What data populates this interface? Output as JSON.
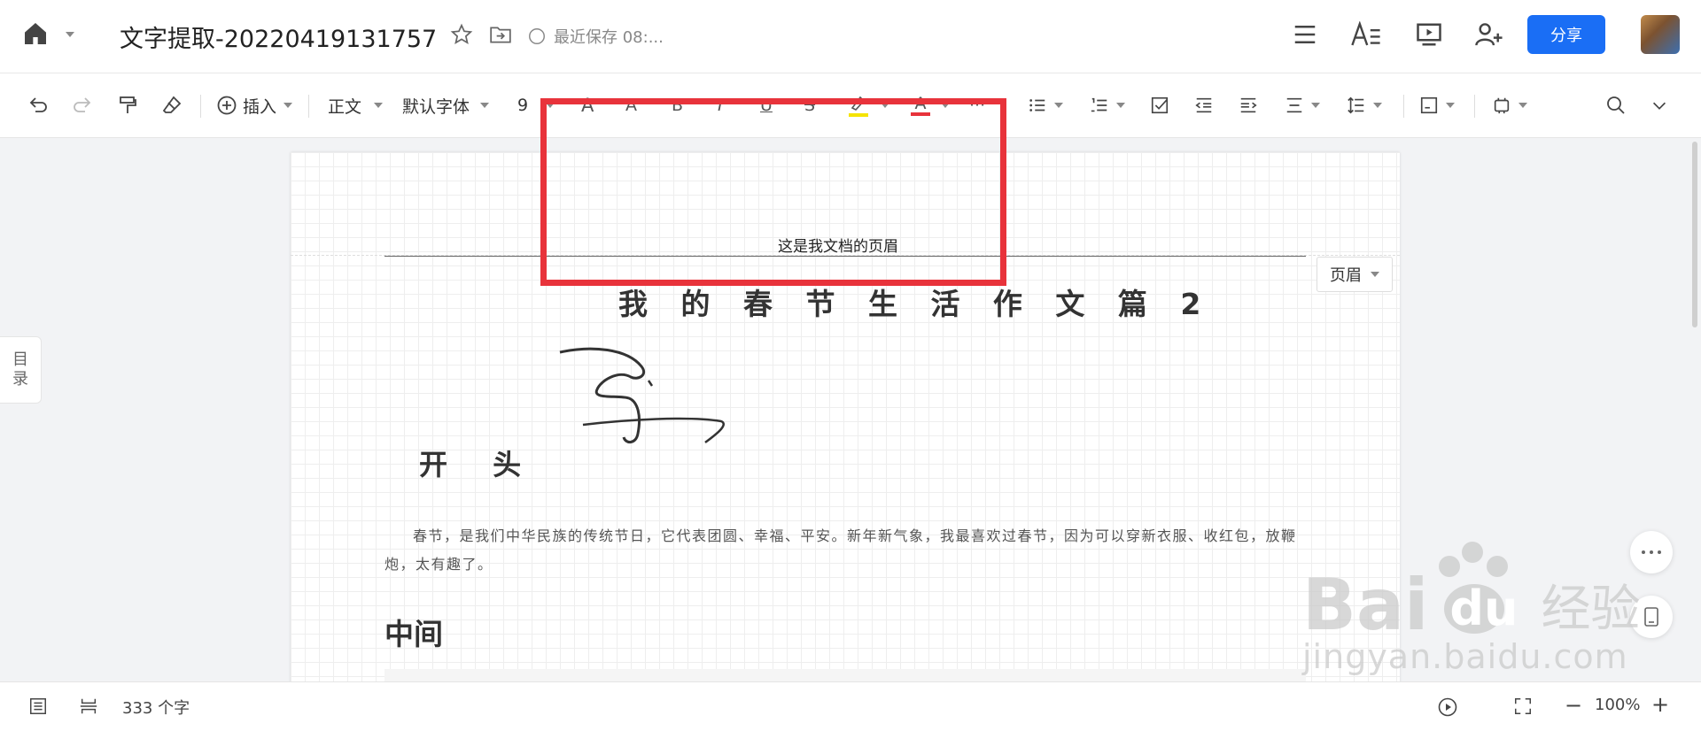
{
  "topbar": {
    "doc_title": "文字提取-20220419131757",
    "save_status": "最近保存 08:...",
    "share_label": "分享"
  },
  "toolbar": {
    "insert_label": "插入",
    "style_label": "正文",
    "font_label": "默认字体",
    "font_size": "9",
    "grow_font": "A",
    "shrink_font": "A",
    "bold": "B",
    "italic": "I",
    "underline": "U",
    "strike": "S",
    "more": "···",
    "font_color_letter": "A",
    "highlight_color": "#f5e400",
    "font_color": "#e8333b"
  },
  "document": {
    "header_text": "这是我文档的页眉",
    "title": "我 的 春 节 生 活 作 文 篇 2",
    "heading_start": "开 头",
    "paragraph": "春节，是我们中华民族的传统节日，它代表团圆、幸福、平安。新年新气象，我最喜欢过春节，因为可以穿新衣服、收红包，放鞭炮，太有趣了。",
    "heading_middle": "中间",
    "header_tag": "页眉"
  },
  "sidebar": {
    "toc_line1": "目",
    "toc_line2": "录"
  },
  "statusbar": {
    "word_count": "333 个字",
    "zoom": "100%"
  },
  "watermark": {
    "brand": "Bai",
    "brand2": "du",
    "brand3": "经验",
    "url": "jingyan.baidu.com"
  },
  "colors": {
    "accent": "#1a6ef5",
    "highlight_box": "#e8333b"
  }
}
